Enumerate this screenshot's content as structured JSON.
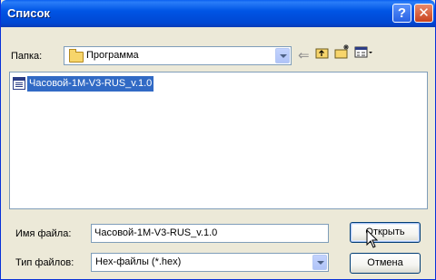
{
  "window": {
    "title": "Список"
  },
  "header": {
    "folder_label": "Папка:",
    "folder_value": "Программа"
  },
  "files": [
    {
      "name": "Часовой-1М-V3-RUS_v.1.0",
      "selected": true
    }
  ],
  "footer": {
    "filename_label": "Имя файла:",
    "filename_value": "Часовой-1М-V3-RUS_v.1.0",
    "filetype_label": "Тип файлов:",
    "filetype_value": "Hex-файлы (*.hex)",
    "open_label": "Открыть",
    "cancel_label": "Отмена"
  },
  "icons": {
    "help": "help-icon",
    "close": "close-icon",
    "folder": "folder-icon",
    "back": "back-arrow-icon",
    "up": "up-folder-icon",
    "new_folder": "new-folder-icon",
    "view_menu": "view-menu-icon",
    "file": "file-icon",
    "cursor": "mouse-cursor-icon"
  },
  "colors": {
    "titlebar": "#0055e5",
    "selection": "#316ac5",
    "dialog_bg": "#ece9d8"
  }
}
